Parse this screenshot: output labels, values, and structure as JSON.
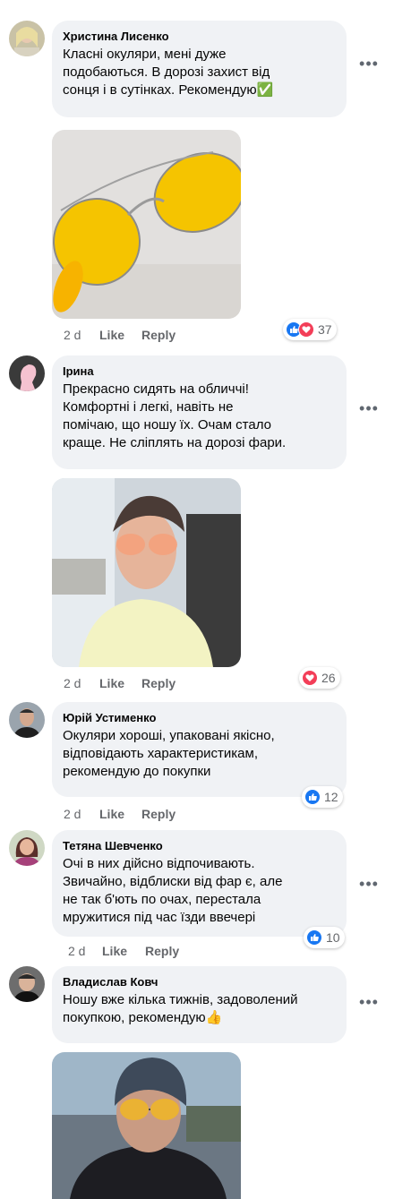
{
  "action_labels": {
    "like": "Like",
    "reply": "Reply"
  },
  "more_glyph": "•••",
  "comments": [
    {
      "author": "Христина Лисенко",
      "text": "Класні окуляри, мені дуже\nподобаються. В дорозі захист від\nсонця і в сутінках. Рекомендую✅",
      "time": "2 d",
      "reaction_count": "37",
      "reactions": [
        "like-icon",
        "love-icon"
      ]
    },
    {
      "author": "Ірина",
      "text": "Прекрасно сидять на обличчі!\nКомфортні і легкі, навіть не\nпомічаю, що ношу їх. Очам стало\nкраще. Не сліплять на дорозі фари.",
      "time": "2 d",
      "reaction_count": "26",
      "reactions": [
        "love-icon"
      ]
    },
    {
      "author": "Юрій Устименко",
      "text": "Окуляри хороші, упаковані якісно,\nвідповідають характеристикам,\nрекомендую до покупки",
      "time": "2 d",
      "reaction_count": "12",
      "reactions": [
        "like-icon"
      ]
    },
    {
      "author": "Тетяна Шевченко",
      "text": "Очі в них дійсно відпочивають.\nЗвичайно, відблиски від фар є, але\nне так б'ють по очах, перестала\nмружитися під час їзди ввечері",
      "time": "2 d",
      "reaction_count": "10",
      "reactions": [
        "like-icon"
      ]
    },
    {
      "author": "Владислав Ковч",
      "text": "Ношу вже кілька тижнів, задоволений\nпокупкою, рекомендую👍",
      "time": "",
      "reaction_count": "",
      "reactions": []
    }
  ],
  "colors": {
    "like": "#1877f2",
    "love": "#f33e58",
    "bubble": "#f0f2f5",
    "meta": "#65676b"
  }
}
